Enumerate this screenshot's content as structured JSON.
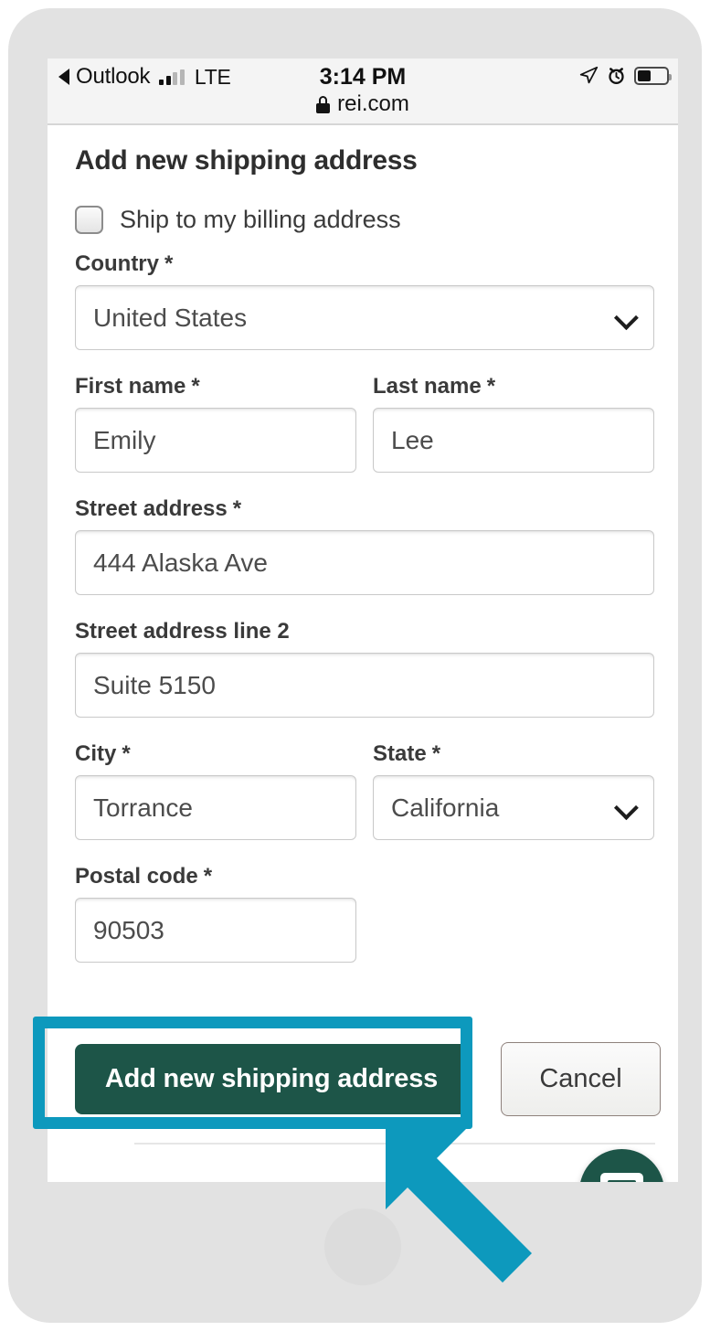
{
  "status_bar": {
    "back_app": "Outlook",
    "network": "LTE",
    "signal_bars_total": 4,
    "signal_bars_active": 2,
    "time": "3:14 PM",
    "url": "rei.com",
    "battery_percent": 41,
    "icons": [
      "location-arrow-icon",
      "alarm-clock-icon",
      "battery-icon"
    ]
  },
  "page": {
    "title": "Add new shipping address",
    "billing_checkbox": {
      "label": "Ship to my billing address",
      "checked": false
    },
    "fields": {
      "country": {
        "label": "Country",
        "required": "*",
        "value": "United States",
        "type": "select"
      },
      "first_name": {
        "label": "First name",
        "required": "*",
        "value": "Emily",
        "type": "text"
      },
      "last_name": {
        "label": "Last name",
        "required": "*",
        "value": "Lee",
        "type": "text"
      },
      "street_address": {
        "label": "Street address",
        "required": "*",
        "value": "444 Alaska Ave",
        "type": "text"
      },
      "street_address_2": {
        "label": "Street address line 2",
        "required": "",
        "value": "Suite 5150",
        "type": "text"
      },
      "city": {
        "label": "City",
        "required": "*",
        "value": "Torrance",
        "type": "text"
      },
      "state": {
        "label": "State",
        "required": "*",
        "value": "California",
        "type": "select"
      },
      "postal_code": {
        "label": "Postal code",
        "required": "*",
        "value": "90503",
        "type": "text"
      }
    },
    "actions": {
      "submit_label": "Add new shipping address",
      "cancel_label": "Cancel"
    },
    "chat_fab": {
      "icon": "chat-bubble-icon"
    }
  },
  "annotations": {
    "highlight_target": "Add new shipping address",
    "highlight_color": "#0d99bd",
    "arrow_color": "#0d99bd",
    "arrow_direction": "up-left"
  },
  "colors": {
    "brand_green": "#1d5548",
    "annotation_cyan": "#0d99bd",
    "frame_gray": "#e2e2e2",
    "status_bar_gray": "#f4f4f4"
  }
}
